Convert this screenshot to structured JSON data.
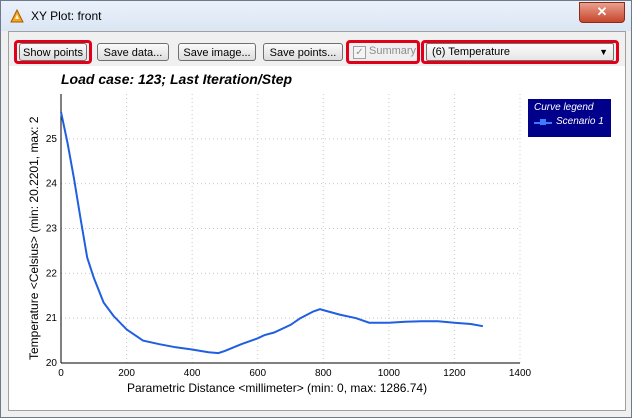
{
  "window": {
    "title": "XY Plot: front",
    "close_glyph": "✕"
  },
  "toolbar": {
    "show_points": "Show points",
    "save_data": "Save data...",
    "save_image": "Save image...",
    "save_points": "Save points...",
    "summary_label": "Summary",
    "summary_checked": true,
    "quantity_selected": "(6) Temperature"
  },
  "plot": {
    "title": "Load case: 123; Last Iteration/Step",
    "legend_title": "Curve legend",
    "colors": {
      "curve": "#1f5fe0",
      "legend_bg": "#00008b",
      "highlight": "#e0001a"
    }
  },
  "chart_data": {
    "type": "line",
    "title": "Load case: 123; Last Iteration/Step",
    "xlabel": "Parametric Distance <millimeter> (min: 0, max: 1286.74)",
    "ylabel": "Temperature <Celsius> (min: 20.2201, max: 2",
    "xlim": [
      0,
      1400
    ],
    "ylim": [
      20,
      26
    ],
    "xticks": [
      0,
      200,
      400,
      600,
      800,
      1000,
      1200,
      1400
    ],
    "yticks": [
      20,
      21,
      22,
      23,
      24,
      25
    ],
    "grid": true,
    "legend_position": "top-right",
    "series": [
      {
        "name": "Scenario 1",
        "x": [
          0,
          20,
          40,
          60,
          80,
          100,
          130,
          160,
          200,
          250,
          300,
          350,
          400,
          450,
          480,
          500,
          550,
          600,
          620,
          650,
          700,
          730,
          770,
          790,
          800,
          850,
          900,
          940,
          1000,
          1050,
          1100,
          1150,
          1200,
          1250,
          1286.74
        ],
        "y": [
          25.6,
          24.9,
          24.1,
          23.2,
          22.35,
          21.9,
          21.35,
          21.05,
          20.75,
          20.5,
          20.42,
          20.35,
          20.3,
          20.24,
          20.22,
          20.27,
          20.42,
          20.55,
          20.62,
          20.68,
          20.85,
          21.0,
          21.15,
          21.2,
          21.18,
          21.08,
          21.0,
          20.9,
          20.9,
          20.92,
          20.93,
          20.93,
          20.9,
          20.87,
          20.82
        ]
      }
    ]
  }
}
